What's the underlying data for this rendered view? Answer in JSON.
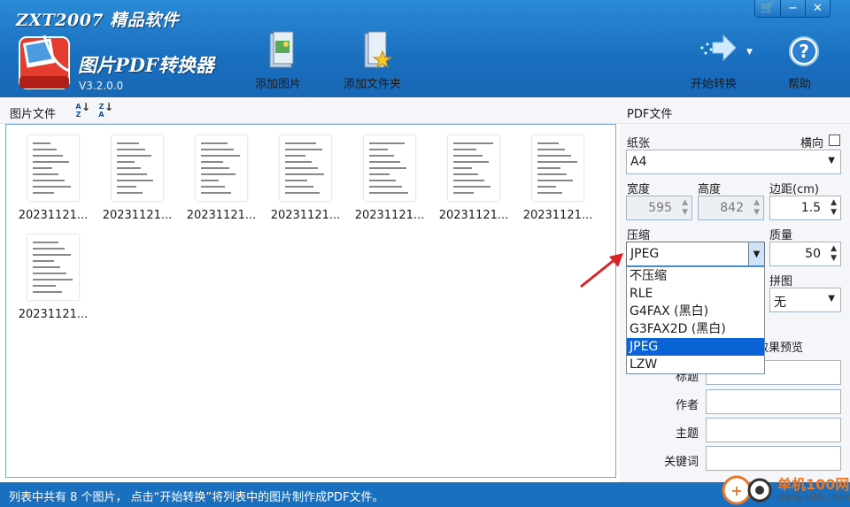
{
  "header": {
    "brand": "ZXT2007 精品软件",
    "title": "图片PDF转换器",
    "version": "V3.2.0.0",
    "buttons": {
      "add_image": "添加图片",
      "add_folder": "添加文件夹",
      "start": "开始转换",
      "help": "帮助"
    },
    "window_controls": {
      "store": "🛒",
      "minimize": "−",
      "close": "✕"
    }
  },
  "left_panel": {
    "label": "图片文件",
    "sort_az": "AZ",
    "sort_za": "ZA",
    "files": [
      "20231121...",
      "20231121...",
      "20231121...",
      "20231121...",
      "20231121...",
      "20231121...",
      "20231121...",
      "20231121..."
    ]
  },
  "right_panel": {
    "heading": "PDF文件",
    "paper_label": "纸张",
    "landscape_label": "横向",
    "paper_value": "A4",
    "width_label": "宽度",
    "width_value": "595",
    "height_label": "高度",
    "height_value": "842",
    "margin_label": "边距(cm)",
    "margin_value": "1.5",
    "compress_label": "压缩",
    "compress_value": "JPEG",
    "quality_label": "质量",
    "quality_value": "50",
    "merge_label": "拼图",
    "merge_value": "无",
    "preview_label_partial": "效果预览",
    "title_label_partial": "标题",
    "author_label": "作者",
    "subject_label": "主题",
    "keywords_label": "关键词"
  },
  "compress_options": [
    "不压缩",
    "RLE",
    "G4FAX (黑白)",
    "G3FAX2D (黑白)",
    "JPEG",
    "LZW"
  ],
  "status_bar": {
    "text": "列表中共有 8 个图片， 点击“开始转换”将列表中的图片制作成PDF文件。"
  },
  "watermark": {
    "cn": "单机100网",
    "url": "danji100.com"
  },
  "colors": {
    "header_blue": "#1a6fbf",
    "selection_blue": "#0a64d6",
    "annotation_red": "#d9232b"
  }
}
